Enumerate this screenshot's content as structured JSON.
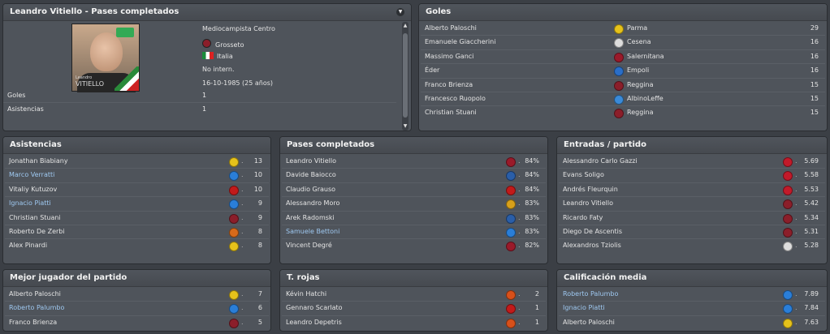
{
  "player_panel": {
    "title": "Leandro Vitiello - Pases completados",
    "photo_name_small": "Leandro",
    "photo_name_big": "VITIELLO",
    "position": "Mediocampista Centro",
    "club": "Grosseto",
    "nation": "Italia",
    "intl": "No intern.",
    "dob": "16-10-1985 (25 años)",
    "stats": [
      {
        "label": "Goles",
        "value": "1"
      },
      {
        "label": "Asistencias",
        "value": "1"
      }
    ]
  },
  "panels": {
    "goles": {
      "title": "Goles",
      "rows": [
        {
          "name": "Alberto Paloschi",
          "club": "Parma",
          "value": "29",
          "color": "#e6c21a",
          "link": false
        },
        {
          "name": "Emanuele Giaccherini",
          "club": "Cesena",
          "value": "16",
          "color": "#dddddd",
          "link": false
        },
        {
          "name": "Massimo Ganci",
          "club": "Salernitana",
          "value": "16",
          "color": "#9a1a2a",
          "link": false
        },
        {
          "name": "Éder",
          "club": "Empoli",
          "value": "16",
          "color": "#2a6ec8",
          "link": false
        },
        {
          "name": "Franco Brienza",
          "club": "Reggina",
          "value": "15",
          "color": "#8b1e2a",
          "link": false
        },
        {
          "name": "Francesco Ruopolo",
          "club": "AlbinoLeffe",
          "value": "15",
          "color": "#3a8ad8",
          "link": false
        },
        {
          "name": "Christian Stuani",
          "club": "Reggina",
          "value": "15",
          "color": "#8b1e2a",
          "link": false
        }
      ]
    },
    "asistencias": {
      "title": "Asistencias",
      "rows": [
        {
          "name": "Jonathan Biabiany",
          "value": "13",
          "color": "#e6c21a",
          "link": false
        },
        {
          "name": "Marco Verratti",
          "value": "10",
          "color": "#2a7ed8",
          "link": true
        },
        {
          "name": "Vitaliy Kutuzov",
          "value": "10",
          "color": "#c21a1a",
          "link": false
        },
        {
          "name": "Ignacio Piatti",
          "value": "9",
          "color": "#2a7ed8",
          "link": true
        },
        {
          "name": "Christian Stuani",
          "value": "9",
          "color": "#8b1e2a",
          "link": false
        },
        {
          "name": "Roberto De Zerbi",
          "value": "8",
          "color": "#d86a1a",
          "link": false
        },
        {
          "name": "Alex Pinardi",
          "value": "8",
          "color": "#e6c21a",
          "link": false
        }
      ]
    },
    "pases": {
      "title": "Pases completados",
      "rows": [
        {
          "name": "Leandro Vitiello",
          "value": "84%",
          "color": "#9a1a2a",
          "link": false
        },
        {
          "name": "Davide Baiocco",
          "value": "84%",
          "color": "#2a5ea8",
          "link": false
        },
        {
          "name": "Claudio Grauso",
          "value": "84%",
          "color": "#c21a1a",
          "link": false
        },
        {
          "name": "Alessandro Moro",
          "value": "83%",
          "color": "#d8a01a",
          "link": false
        },
        {
          "name": "Arek Radomski",
          "value": "83%",
          "color": "#2a5ea8",
          "link": false
        },
        {
          "name": "Samuele Bettoni",
          "value": "83%",
          "color": "#2a7ed8",
          "link": true
        },
        {
          "name": "Vincent Degré",
          "value": "82%",
          "color": "#9a1a2a",
          "link": false
        }
      ]
    },
    "entradas": {
      "title": "Entradas / partido",
      "rows": [
        {
          "name": "Alessandro Carlo Gazzi",
          "value": "5.69",
          "color": "#c21a2a",
          "link": false
        },
        {
          "name": "Evans Soligo",
          "value": "5.58",
          "color": "#c21a2a",
          "link": false
        },
        {
          "name": "Andrés Fleurquin",
          "value": "5.53",
          "color": "#c21a2a",
          "link": false
        },
        {
          "name": "Leandro Vitiello",
          "value": "5.42",
          "color": "#8b1e2a",
          "link": false
        },
        {
          "name": "Ricardo Faty",
          "value": "5.34",
          "color": "#8b1e2a",
          "link": false
        },
        {
          "name": "Diego De Ascentis",
          "value": "5.31",
          "color": "#8b1e2a",
          "link": false
        },
        {
          "name": "Alexandros Tziolis",
          "value": "5.28",
          "color": "#dddddd",
          "link": false
        }
      ]
    },
    "mejor": {
      "title": "Mejor jugador del partido",
      "rows": [
        {
          "name": "Alberto Paloschi",
          "value": "7",
          "color": "#e6c21a",
          "link": false
        },
        {
          "name": "Roberto Palumbo",
          "value": "6",
          "color": "#2a7ed8",
          "link": true
        },
        {
          "name": "Franco Brienza",
          "value": "5",
          "color": "#8b1e2a",
          "link": false
        }
      ]
    },
    "rojas": {
      "title": "T. rojas",
      "rows": [
        {
          "name": "Kévin Hatchi",
          "value": "2",
          "color": "#d8501a",
          "link": false
        },
        {
          "name": "Gennaro Scarlato",
          "value": "1",
          "color": "#c21a1a",
          "link": false
        },
        {
          "name": "Leandro Depetris",
          "value": "1",
          "color": "#d8501a",
          "link": false
        }
      ]
    },
    "calificacion": {
      "title": "Calificación media",
      "rows": [
        {
          "name": "Roberto Palumbo",
          "value": "7.89",
          "color": "#2a7ed8",
          "link": true
        },
        {
          "name": "Ignacio Piatti",
          "value": "7.84",
          "color": "#2a7ed8",
          "link": true
        },
        {
          "name": "Alberto Paloschi",
          "value": "7.63",
          "color": "#e6c21a",
          "link": false
        }
      ]
    }
  }
}
